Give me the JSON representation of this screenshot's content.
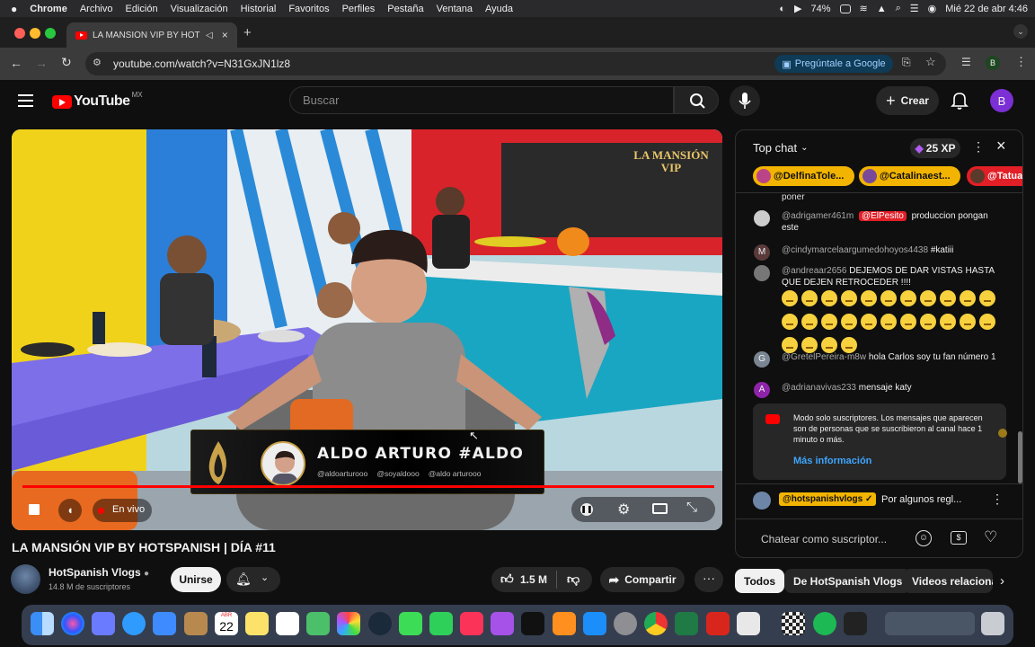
{
  "menubar": {
    "app": "Chrome",
    "items": [
      "Archivo",
      "Edición",
      "Visualización",
      "Historial",
      "Favoritos",
      "Perfiles",
      "Pestaña",
      "Ventana",
      "Ayuda"
    ],
    "battery": "74%",
    "datetime": "Mié 22 de abr  4:46"
  },
  "tab": {
    "title": "LA MANSIÓN VIP BY HOT"
  },
  "address": {
    "url": "youtube.com/watch?v=N31GxJN1lz8",
    "ask_google": "Pregúntale a Google",
    "profile_initial": "B"
  },
  "youtube": {
    "logo_text": "YouTube",
    "region": "MX",
    "search_placeholder": "Buscar",
    "create_label": "Crear",
    "avatar_initial": "B"
  },
  "video": {
    "lower_third_name": "ALDO ARTURO #ALDO",
    "handles": [
      "@aldoarturooo",
      "@soyaldooo",
      "@aldo arturooo"
    ],
    "live_label": "En vivo",
    "watermark": "LA MANSIÓN VIP",
    "title": "LA MANSIÓN VIP BY HOTSPANISH | DÍA #11",
    "channel": "HotSpanish Vlogs",
    "subscribers": "14.8 M de suscriptores",
    "join_label": "Unirse",
    "likes": "1.5 M",
    "share_label": "Compartir"
  },
  "chat": {
    "mode": "Top chat",
    "xp": "25 XP",
    "pinned_users": [
      "@DelfinaTole...",
      "@Catalinaest...",
      "@Tatua"
    ],
    "partial_top": "poner",
    "messages": [
      {
        "author": "@adrigamer461m",
        "mention": "@ElPesito",
        "text": "produccion pongan este"
      },
      {
        "author": "@cindymarcelaargumedohoyos4438",
        "text": "#katiii",
        "initial": "M"
      },
      {
        "author": "@andreaar2656",
        "text": "DEJEMOS DE DAR VISTAS HASTA QUE DEJEN RETROCEDER !!!!"
      },
      {
        "author": "@GretelPereira-m8w",
        "text": "hola Carlos soy tu fan número 1",
        "initial": "G"
      },
      {
        "author": "@adrianavivas233",
        "text": "mensaje katy",
        "initial": "A"
      }
    ],
    "subscribers_only": "Modo solo suscriptores. Los mensajes que aparecen son de personas que se suscribieron al canal hace 1 minuto o más.",
    "more_info": "Más información",
    "pinned_author": "@hotspanishvlogs",
    "pinned_text": "Por algunos regl...",
    "input_placeholder": "Chatear como suscriptor..."
  },
  "chips": [
    "Todos",
    "De HotSpanish Vlogs",
    "Videos relaciona"
  ],
  "dock": {
    "calendar_month": "ABR",
    "calendar_day": "22"
  },
  "colors": {
    "accent_red": "#ff0000",
    "gold": "#f2b400",
    "link_blue": "#3ea6ff"
  }
}
